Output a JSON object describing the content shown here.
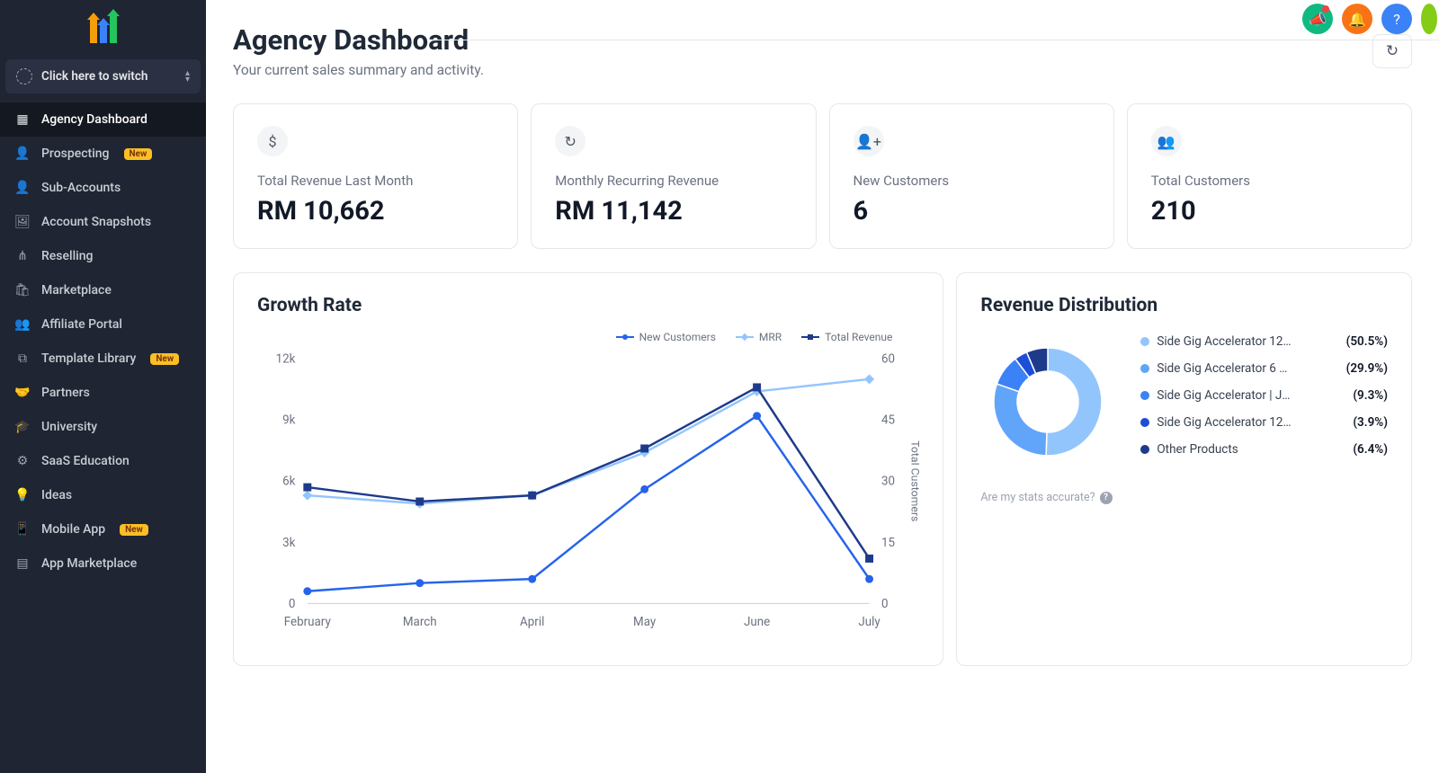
{
  "sidebar": {
    "switch_label": "Click here to switch",
    "items": [
      {
        "label": "Agency Dashboard",
        "badge": "",
        "icon": "grid"
      },
      {
        "label": "Prospecting",
        "badge": "New",
        "icon": "user-search"
      },
      {
        "label": "Sub-Accounts",
        "badge": "",
        "icon": "user"
      },
      {
        "label": "Account Snapshots",
        "badge": "",
        "icon": "image"
      },
      {
        "label": "Reselling",
        "badge": "",
        "icon": "nodes"
      },
      {
        "label": "Marketplace",
        "badge": "",
        "icon": "bag"
      },
      {
        "label": "Affiliate Portal",
        "badge": "",
        "icon": "users"
      },
      {
        "label": "Template Library",
        "badge": "New",
        "icon": "cubes"
      },
      {
        "label": "Partners",
        "badge": "",
        "icon": "handshake"
      },
      {
        "label": "University",
        "badge": "",
        "icon": "grad"
      },
      {
        "label": "SaaS Education",
        "badge": "",
        "icon": "gear-cube"
      },
      {
        "label": "Ideas",
        "badge": "",
        "icon": "bulb"
      },
      {
        "label": "Mobile App",
        "badge": "New",
        "icon": "phone"
      },
      {
        "label": "App Marketplace",
        "badge": "",
        "icon": "apps"
      }
    ]
  },
  "header": {
    "title": "Agency Dashboard",
    "subtitle": "Your current sales summary and activity."
  },
  "kpis": [
    {
      "label": "Total Revenue Last Month",
      "value": "RM 10,662",
      "icon": "$"
    },
    {
      "label": "Monthly Recurring Revenue",
      "value": "RM 11,142",
      "icon": "↻"
    },
    {
      "label": "New Customers",
      "value": "6",
      "icon": "👤"
    },
    {
      "label": "Total Customers",
      "value": "210",
      "icon": "👥"
    }
  ],
  "growth_panel": {
    "title": "Growth Rate",
    "legend": [
      "New Customers",
      "MRR",
      "Total Revenue"
    ]
  },
  "revenue_panel": {
    "title": "Revenue Distribution",
    "items": [
      {
        "label": "Side Gig Accelerator 12…",
        "pct": "(50.5%)",
        "color": "#93c5fd"
      },
      {
        "label": "Side Gig Accelerator 6 …",
        "pct": "(29.9%)",
        "color": "#60a5fa"
      },
      {
        "label": "Side Gig Accelerator | J…",
        "pct": "(9.3%)",
        "color": "#3b82f6"
      },
      {
        "label": "Side Gig Accelerator 12…",
        "pct": "(3.9%)",
        "color": "#1d4ed8"
      },
      {
        "label": "Other Products",
        "pct": "(6.4%)",
        "color": "#1e3a8a"
      }
    ],
    "accuracy_text": "Are my stats accurate?"
  },
  "chart_data": [
    {
      "type": "line",
      "title": "Growth Rate",
      "categories": [
        "February",
        "March",
        "April",
        "May",
        "June",
        "July"
      ],
      "y_left_label": "",
      "y_left_ticks": [
        0,
        "3k",
        "6k",
        "9k",
        "12k"
      ],
      "y_right_label": "Total Customers",
      "y_right_ticks": [
        0,
        15,
        30,
        45,
        60
      ],
      "series": [
        {
          "name": "New Customers",
          "axis": "left",
          "values": [
            600,
            1000,
            1200,
            5600,
            9200,
            1200
          ],
          "color": "#2563eb"
        },
        {
          "name": "MRR",
          "axis": "left",
          "values": [
            5300,
            4900,
            5300,
            7400,
            10400,
            11000
          ],
          "color": "#93c5fd"
        },
        {
          "name": "Total Revenue",
          "axis": "left",
          "values": [
            5700,
            5000,
            5300,
            7600,
            10600,
            2200
          ],
          "color": "#1e3a8a"
        }
      ]
    },
    {
      "type": "pie",
      "title": "Revenue Distribution",
      "slices": [
        {
          "label": "Side Gig Accelerator 12…",
          "value": 50.5,
          "color": "#93c5fd"
        },
        {
          "label": "Side Gig Accelerator 6 …",
          "value": 29.9,
          "color": "#60a5fa"
        },
        {
          "label": "Side Gig Accelerator | J…",
          "value": 9.3,
          "color": "#3b82f6"
        },
        {
          "label": "Side Gig Accelerator 12…",
          "value": 3.9,
          "color": "#1d4ed8"
        },
        {
          "label": "Other Products",
          "value": 6.4,
          "color": "#1e3a8a"
        }
      ]
    }
  ]
}
